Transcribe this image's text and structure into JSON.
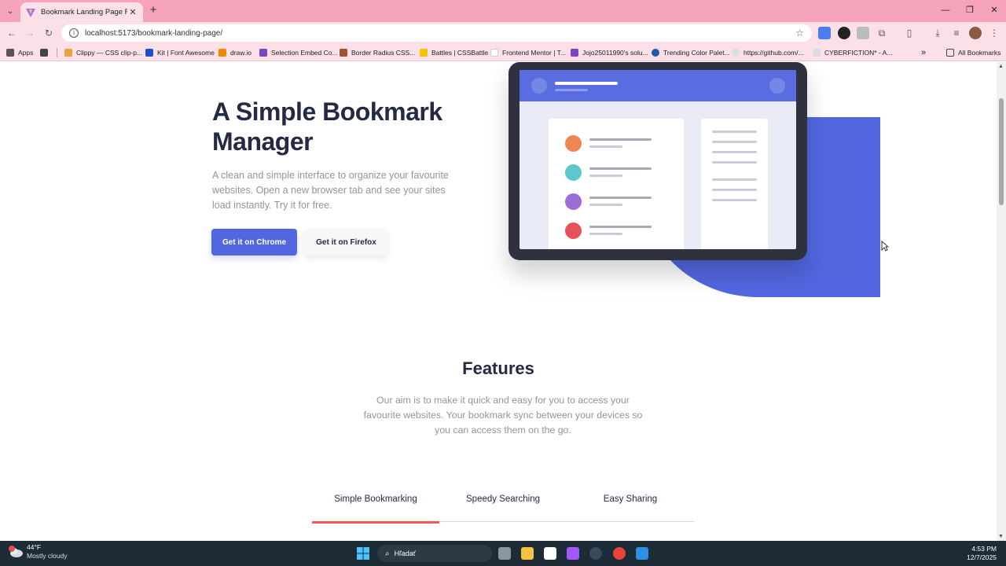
{
  "browser": {
    "tab_title": "Bookmark Landing Page React",
    "url": "localhost:5173/bookmark-landing-page/",
    "bookmarks": [
      {
        "label": "Apps"
      },
      {
        "label": "Clippy — CSS clip-p..."
      },
      {
        "label": "Kit | Font Awesome"
      },
      {
        "label": "draw.io"
      },
      {
        "label": "Selection Embed Co..."
      },
      {
        "label": "Border Radius CSS..."
      },
      {
        "label": "Battles | CSSBattle"
      },
      {
        "label": "Frontend Mentor | T..."
      },
      {
        "label": "Jojo25011990's solu..."
      },
      {
        "label": "Trending Color Palet..."
      },
      {
        "label": "https://github.com/..."
      },
      {
        "label": "CYBERFICTION* - A..."
      }
    ],
    "all_bookmarks": "All Bookmarks",
    "more_glyph": "»"
  },
  "hero": {
    "title": "A Simple Bookmark Manager",
    "description": "A clean and simple interface to organize your favourite websites. Open a new browser tab and see your sites load instantly. Try it for free.",
    "chrome_button": "Get it on Chrome",
    "firefox_button": "Get it on Firefox"
  },
  "features": {
    "title": "Features",
    "description": "Our aim is to make it quick and easy for you to access your favourite websites. Your bookmark sync between your devices so you can access them on the go.",
    "tabs": [
      {
        "label": "Simple Bookmarking",
        "active": true
      },
      {
        "label": "Speedy Searching",
        "active": false
      },
      {
        "label": "Easy Sharing",
        "active": false
      }
    ]
  },
  "colors": {
    "primary": "#5267df",
    "accent_red": "#fa5757",
    "dark": "#242a45",
    "grey_text": "#9194a2",
    "bookmark_dots": [
      "#ef8553",
      "#5cc7cd",
      "#9a6cd7",
      "#e6515b"
    ]
  },
  "taskbar": {
    "weather_temp": "44°F",
    "weather_desc": "Mostly cloudy",
    "search_text": "Hľadať",
    "time": "4:53 PM",
    "date": "12/7/2025"
  }
}
